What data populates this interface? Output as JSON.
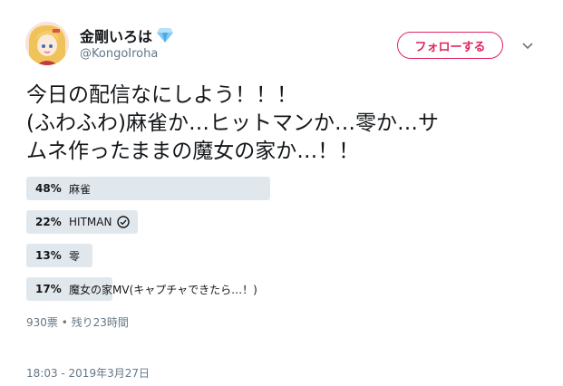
{
  "user": {
    "display_name": "金剛いろは",
    "handle": "@KongoIroha",
    "badge_icon": "diamond-icon"
  },
  "follow_button": {
    "label": "フォローする",
    "color": "#e0245e"
  },
  "tweet": {
    "lines": [
      "今日の配信なにしよう！！！",
      "(ふわふわ)麻雀か…ヒットマンか…零か…サ",
      "ムネ作ったままの魔女の家か…！！"
    ]
  },
  "poll": {
    "options": [
      {
        "percent_label": "48%",
        "percent": 48,
        "label": "麻雀",
        "selected": false
      },
      {
        "percent_label": "22%",
        "percent": 22,
        "label": "HITMAN",
        "selected": true
      },
      {
        "percent_label": "13%",
        "percent": 13,
        "label": "零",
        "selected": false
      },
      {
        "percent_label": "17%",
        "percent": 17,
        "label": "魔女の家MV(キャプチャできたら…！)",
        "selected": false
      }
    ],
    "summary": "930票 • 残り23時間"
  },
  "timestamp": "18:03 - 2019年3月27日",
  "colors": {
    "bar": "#e1e8ed",
    "muted": "#657786",
    "accent": "#e0245e"
  }
}
